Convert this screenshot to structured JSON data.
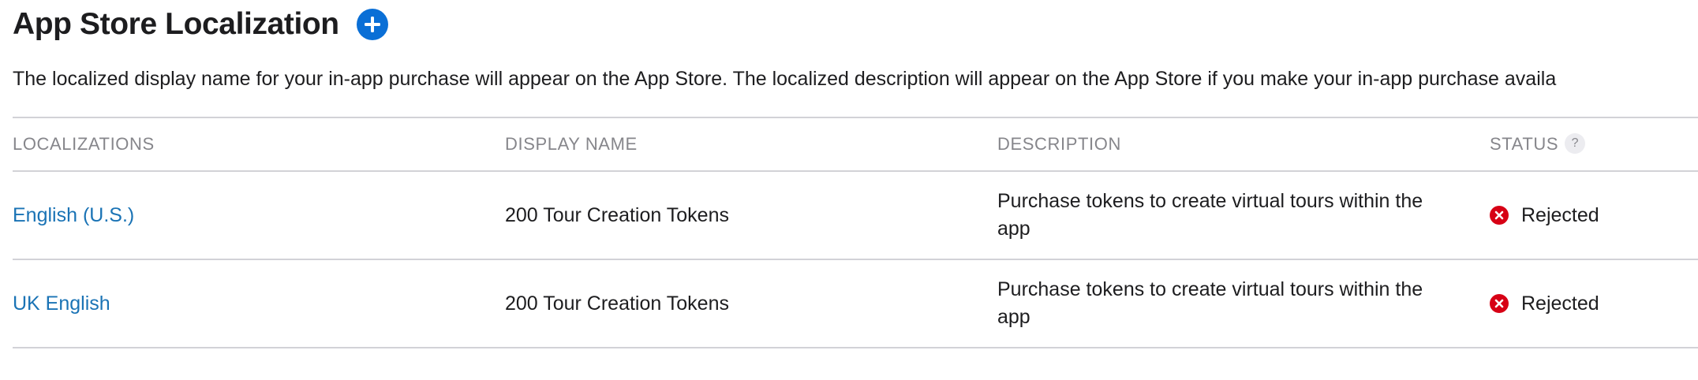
{
  "section": {
    "title": "App Store Localization",
    "description": "The localized display name for your in-app purchase will appear on the App Store. The localized description will appear on the App Store if you make your in-app purchase availa"
  },
  "table": {
    "headers": {
      "localizations": "LOCALIZATIONS",
      "display_name": "DISPLAY NAME",
      "description": "DESCRIPTION",
      "status": "STATUS",
      "status_help": "?"
    },
    "rows": [
      {
        "localization": "English (U.S.)",
        "display_name": "200 Tour Creation Tokens",
        "description": "Purchase tokens to create virtual tours within the app",
        "status": "Rejected"
      },
      {
        "localization": "UK English",
        "display_name": "200 Tour Creation Tokens",
        "description": "Purchase tokens to create virtual tours within the app",
        "status": "Rejected"
      }
    ]
  },
  "icons": {
    "add": "plus-circle-icon",
    "help": "question-circle-icon",
    "rejected": "x-circle-icon"
  },
  "colors": {
    "accent": "#0a6fd6",
    "link": "#1a73b5",
    "rejected": "#d70015",
    "muted": "#86868b",
    "divider": "#d2d2d7"
  }
}
